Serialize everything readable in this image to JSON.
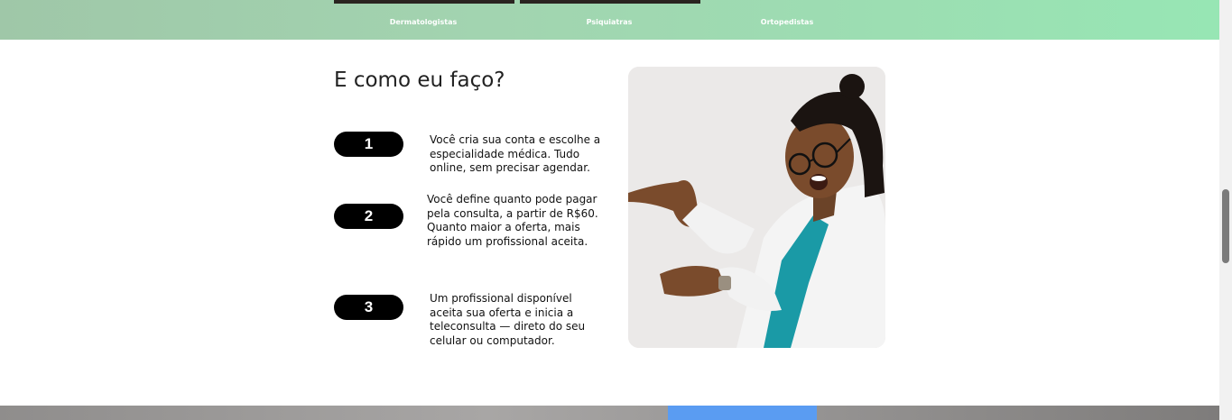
{
  "categories": [
    "Dermatologistas",
    "Psiquiatras",
    "Ortopedistas"
  ],
  "section": {
    "heading": "E como eu faço?"
  },
  "steps": [
    {
      "number": "1",
      "text": "Você cria sua conta e escolhe a especialidade médica. Tudo online, sem precisar agendar."
    },
    {
      "number": "2",
      "text": "Você define quanto pode pagar pela consulta, a partir de R$60. Quanto maior a oferta, mais rápido um profissional aceita."
    },
    {
      "number": "3",
      "text": "Um profissional disponível aceita sua oferta e inicia a teleconsulta — direto do seu celular ou computador."
    }
  ],
  "colors": {
    "band_start": "#9fc7a8",
    "band_end": "#97e6b4",
    "pill": "#000000",
    "scrub_teal": "#1a9aa6"
  },
  "icons": {
    "photo": "doctor-photo"
  }
}
